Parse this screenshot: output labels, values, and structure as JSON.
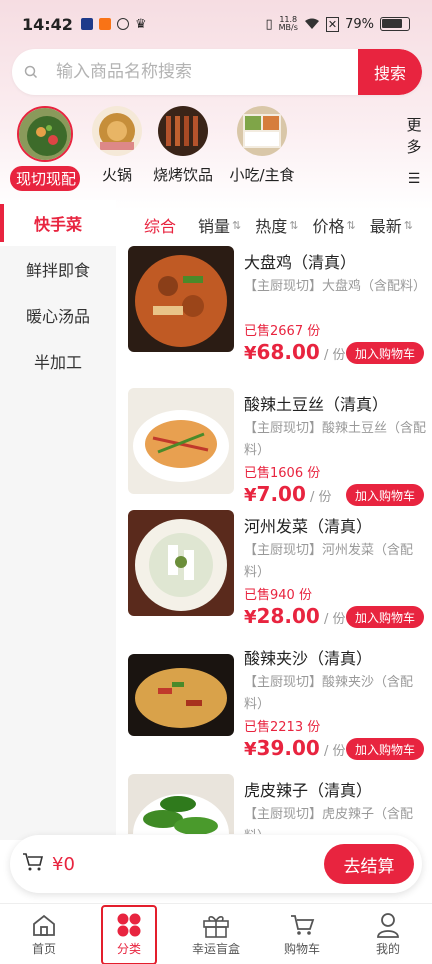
{
  "status_bar": {
    "time": "14:42",
    "net_speed_value": "11.8",
    "net_speed_unit": "MB/s",
    "battery": "79%"
  },
  "search": {
    "placeholder": "输入商品名称搜索",
    "button_label": "搜索"
  },
  "categories": [
    {
      "label": "现切现配",
      "icon": "stir-fry-dish-image",
      "active": true
    },
    {
      "label": "火锅",
      "icon": "hotpot-image"
    },
    {
      "label": "烧烤饮品",
      "icon": "bbq-skewers-image"
    },
    {
      "label": "小吃/主食",
      "icon": "snack-meal-image"
    }
  ],
  "more_label_1": "更",
  "more_label_2": "多",
  "sidebar": {
    "items": [
      {
        "label": "快手菜"
      },
      {
        "label": "鲜拌即食"
      },
      {
        "label": "暖心汤品"
      },
      {
        "label": "半加工"
      }
    ]
  },
  "sort": {
    "items": [
      {
        "label": "综合"
      },
      {
        "label": "销量"
      },
      {
        "label": "热度"
      },
      {
        "label": "价格"
      },
      {
        "label": "最新"
      }
    ]
  },
  "products": [
    {
      "name": "大盘鸡（清真）",
      "desc": "【主厨现切】大盘鸡（含配料）",
      "sold": "已售2667 份",
      "currency": "¥",
      "price": "68.00",
      "unit": "/ 份",
      "button": "加入购物车"
    },
    {
      "name": "酸辣土豆丝（清真）",
      "desc": "【主厨现切】酸辣土豆丝（含配料）",
      "sold": "已售1606 份",
      "currency": "¥",
      "price": "7.00",
      "unit": "/ 份",
      "button": "加入购物车"
    },
    {
      "name": "河州发菜（清真）",
      "desc": "【主厨现切】河州发菜（含配料）",
      "sold": "已售940 份",
      "currency": "¥",
      "price": "28.00",
      "unit": "/ 份",
      "button": "加入购物车"
    },
    {
      "name": "酸辣夹沙（清真）",
      "desc": "【主厨现切】酸辣夹沙（含配料）",
      "sold": "已售2213 份",
      "currency": "¥",
      "price": "39.00",
      "unit": "/ 份",
      "button": "加入购物车"
    },
    {
      "name": "虎皮辣子（清真）",
      "desc": "【主厨现切】虎皮辣子（含配料）",
      "sold": "",
      "currency": "",
      "price": "",
      "unit": "",
      "button": ""
    }
  ],
  "cart": {
    "total": "¥0",
    "checkout_label": "去结算"
  },
  "tabbar": {
    "items": [
      {
        "label": "首页",
        "icon": "home-icon"
      },
      {
        "label": "分类",
        "icon": "category-icon",
        "active": true
      },
      {
        "label": "幸运盲盒",
        "icon": "gift-box-icon"
      },
      {
        "label": "购物车",
        "icon": "cart-icon"
      },
      {
        "label": "我的",
        "icon": "profile-icon"
      }
    ]
  },
  "colors": {
    "accent": "#e8243f",
    "sidebar_bg": "#f6f6f6",
    "header_bg": "#f6dde2"
  }
}
